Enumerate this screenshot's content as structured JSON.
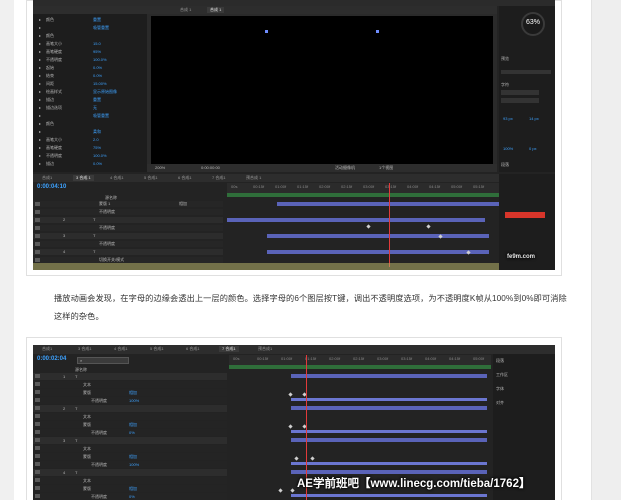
{
  "article": {
    "paragraph": "播放动画会发现，在字母的边缘会透出上一层的颜色。选择字母的6个图层按T键，调出不透明度选项，为不透明度K帧从100%到0%即可消除这样的杂色。"
  },
  "shot1": {
    "comp_tabs": [
      "合成 1",
      "合成 1"
    ],
    "project_rows": [
      {
        "name": "颜色",
        "value": "重置"
      },
      {
        "name": "",
        "value": "吸管重置"
      },
      {
        "name": "颜色",
        "value": ""
      },
      {
        "name": "画笔大小",
        "value": "15.0"
      },
      {
        "name": "画笔硬度",
        "value": "95%"
      },
      {
        "name": "不透明度",
        "value": "100.0%"
      },
      {
        "name": "起始",
        "value": "0.0%"
      },
      {
        "name": "结束",
        "value": "0.0%"
      },
      {
        "name": "间距",
        "value": "15.00%"
      },
      {
        "name": "绘画样式",
        "value": "显示原始图像"
      },
      {
        "name": "描边",
        "value": "重置"
      },
      {
        "name": "描边选项",
        "value": "无"
      },
      {
        "name": "",
        "value": "吸管重置"
      },
      {
        "name": "颜色",
        "value": ""
      },
      {
        "name": "",
        "value": "柔和"
      },
      {
        "name": "画笔大小",
        "value": "2.0"
      },
      {
        "name": "画笔硬度",
        "value": "75%"
      },
      {
        "name": "不透明度",
        "value": "100.0%"
      },
      {
        "name": "描边",
        "value": "0.0%"
      }
    ],
    "viewer_footer": {
      "zoom": "200%",
      "timecode": "0:00:00:00",
      "view": "活动摄像机",
      "views": "1个视图"
    },
    "timeline_tabs": [
      "合成1",
      "3 合成 1",
      "4 合成1",
      "5 合成1",
      "6 合成1",
      "7 合成1",
      "预合成 1"
    ],
    "timecode": "0:00:04:10",
    "layer_header": "源名称",
    "layers": [
      {
        "num": "",
        "name": "蒙版 1",
        "mode": "相加"
      },
      {
        "num": "",
        "name": "不透明度",
        "mode": ""
      },
      {
        "num": "2",
        "name": "T",
        "mode": ""
      },
      {
        "num": "",
        "name": "不透明度",
        "mode": ""
      },
      {
        "num": "3",
        "name": "T",
        "mode": ""
      },
      {
        "num": "",
        "name": "不透明度",
        "mode": ""
      },
      {
        "num": "4",
        "name": "T",
        "mode": ""
      },
      {
        "num": "",
        "name": "切换开关/模式",
        "mode": ""
      }
    ],
    "ruler_ticks": [
      "00s",
      "00:15f",
      "01:00f",
      "01:15f",
      "02:00f",
      "02:15f",
      "03:00f",
      "03:15f",
      "04:00f",
      "04:15f",
      "05:00f",
      "05:15f"
    ],
    "right_panel": {
      "preview": "预览",
      "percent": "63%",
      "character": "字符",
      "paragraph": "段落",
      "values": [
        "93 px",
        "14 px",
        "100%",
        "0 px"
      ]
    },
    "watermark": "fe9m.com"
  },
  "shot2": {
    "tabs": [
      "合成1",
      "3 合成1",
      "4 合成1",
      "5 合成1",
      "6 合成1",
      "7 合成1",
      "预合成1"
    ],
    "timecode": "0:00:02:04",
    "search": "",
    "layer_header": "源名称",
    "layers": [
      {
        "num": "1",
        "name": "T",
        "indent": 0
      },
      {
        "num": "",
        "name": "文本",
        "indent": 1
      },
      {
        "num": "",
        "name": "蒙版",
        "indent": 1
      },
      {
        "num": "",
        "name": "不透明度",
        "indent": 2
      },
      {
        "num": "2",
        "name": "T",
        "indent": 0
      },
      {
        "num": "",
        "name": "文本",
        "indent": 1
      },
      {
        "num": "",
        "name": "蒙版",
        "indent": 1
      },
      {
        "num": "",
        "name": "不透明度",
        "indent": 2
      },
      {
        "num": "3",
        "name": "T",
        "indent": 0
      },
      {
        "num": "",
        "name": "文本",
        "indent": 1
      },
      {
        "num": "",
        "name": "蒙版",
        "indent": 1
      },
      {
        "num": "",
        "name": "不透明度",
        "indent": 2
      },
      {
        "num": "4",
        "name": "T",
        "indent": 0
      },
      {
        "num": "",
        "name": "文本",
        "indent": 1
      },
      {
        "num": "",
        "name": "蒙版",
        "indent": 1
      },
      {
        "num": "",
        "name": "不透明度",
        "indent": 2
      }
    ],
    "modes": [
      "相加",
      "100%",
      "相加",
      "0%",
      "相加",
      "100%",
      "相加",
      "0%"
    ],
    "ruler_ticks": [
      "00s",
      "00:15f",
      "01:00f",
      "01:15f",
      "02:00f",
      "02:15f",
      "03:00f",
      "03:15f",
      "04:00f",
      "04:15f",
      "05:00f"
    ],
    "right_panel": [
      "段落",
      "工作区",
      "字体",
      "对齐"
    ],
    "watermark": "AE学前班吧【www.linecg.com/tieba/1762】"
  },
  "colors": {
    "accent": "#3da2ff",
    "bar": "#5a63b8",
    "playhead": "#e23a3a"
  }
}
